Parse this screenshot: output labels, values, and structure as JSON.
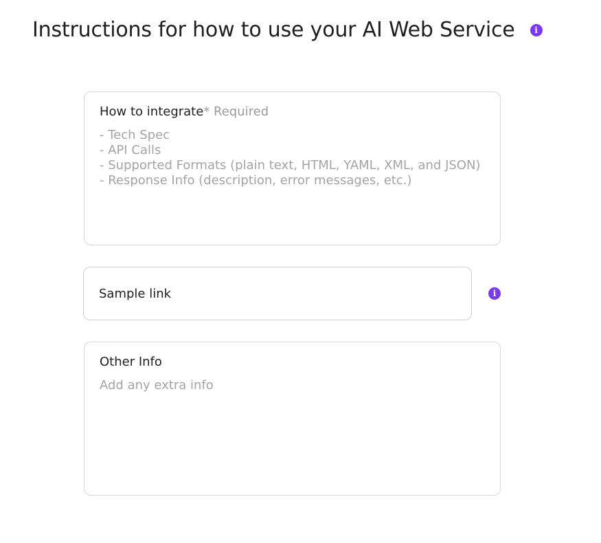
{
  "colors": {
    "accent": "#7c3aed",
    "border": "#d7d7d7",
    "placeholder": "#a4a4a4"
  },
  "header": {
    "title": "Instructions for how to use your AI Web Service",
    "info_icon": "info-icon"
  },
  "integrate": {
    "label": "How to integrate",
    "required_mark": "* Required",
    "placeholder": "- Tech Spec\n- API Calls\n- Supported Formats (plain text, HTML, YAML, XML, and JSON)\n- Response Info (description, error messages, etc.)",
    "value": ""
  },
  "sample_link": {
    "placeholder": "Sample link",
    "value": "",
    "info_icon": "info-icon"
  },
  "other_info": {
    "label": "Other Info",
    "placeholder": "Add any extra info",
    "value": ""
  }
}
